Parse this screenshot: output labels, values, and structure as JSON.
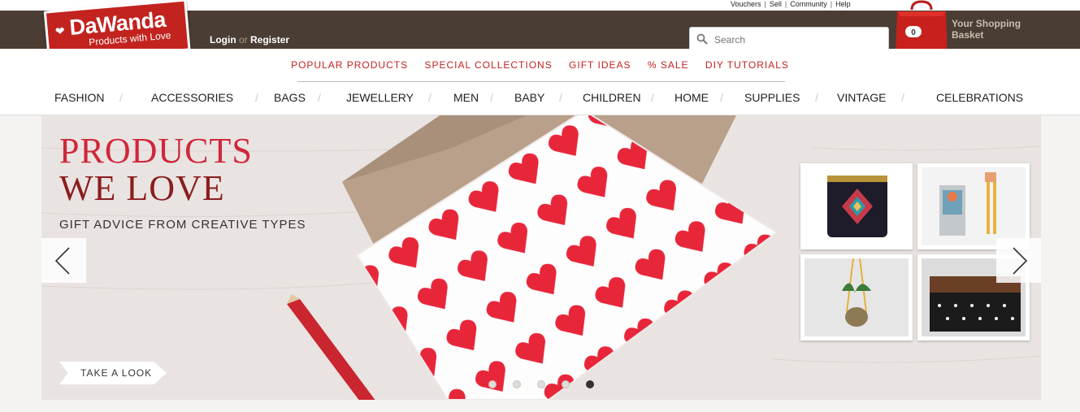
{
  "utility": {
    "links": [
      "Vouchers",
      "Sell",
      "Community",
      "Help"
    ]
  },
  "logo": {
    "name": "DaWanda",
    "tagline": "Products with Love"
  },
  "auth": {
    "login": "Login",
    "or": "or",
    "register": "Register"
  },
  "search": {
    "placeholder": "Search"
  },
  "basket": {
    "count": "0",
    "label_line1": "Your Shopping",
    "label_line2": "Basket"
  },
  "promo_links": [
    "POPULAR PRODUCTS",
    "SPECIAL COLLECTIONS",
    "GIFT IDEAS",
    "% SALE",
    "DIY TUTORIALS"
  ],
  "categories": [
    "FASHION",
    "ACCESSORIES",
    "BAGS",
    "JEWELLERY",
    "MEN",
    "BABY",
    "CHILDREN",
    "HOME",
    "SUPPLIES",
    "VINTAGE",
    "CELEBRATIONS"
  ],
  "hero": {
    "title_line1": "PRODUCTS",
    "title_line2": "WE LOVE",
    "subtitle": "GIFT ADVICE FROM CREATIVE TYPES",
    "cta": "TAKE A LOOK",
    "slide_count": 5,
    "active_slide": 5
  },
  "colors": {
    "brand_red": "#c2231f",
    "topbar": "#4a3d33"
  },
  "icons": {
    "search": "magnifier-icon",
    "basket": "shopping-bag-icon",
    "prev": "chevron-left-icon",
    "next": "chevron-right-icon"
  }
}
